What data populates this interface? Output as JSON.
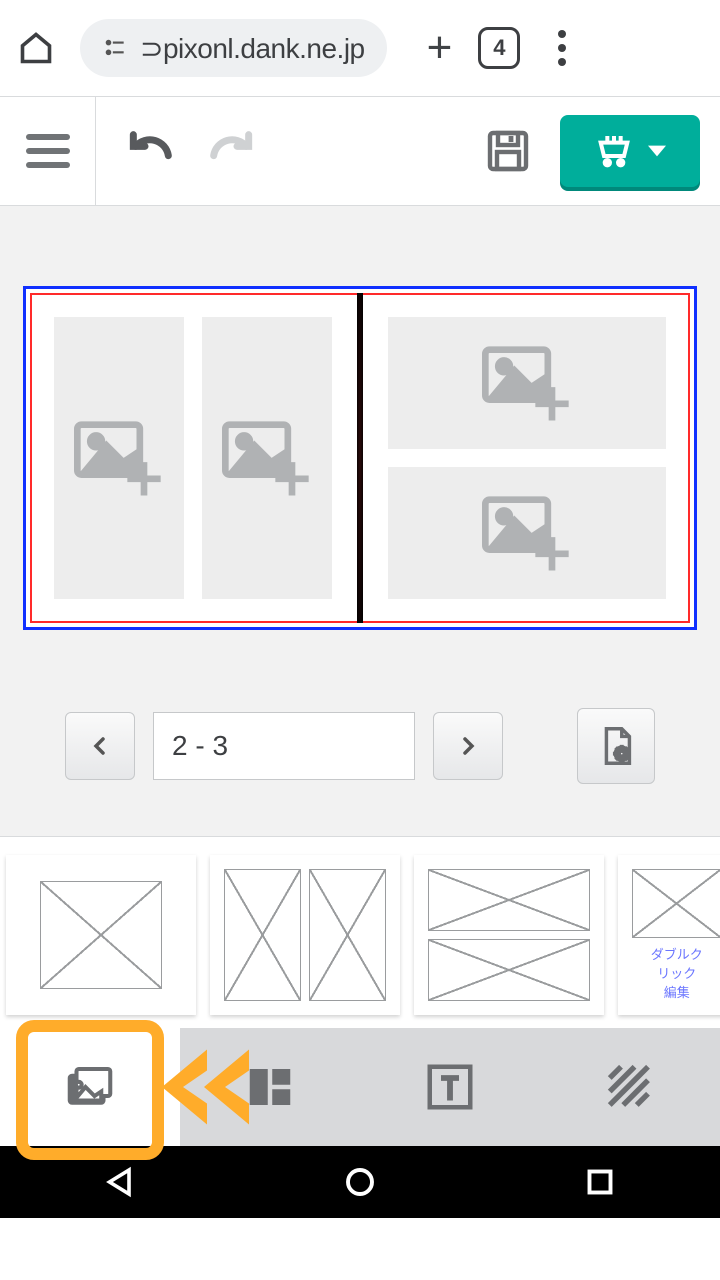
{
  "browser": {
    "url_prefix_icon": "⊃",
    "url": "pixonl.dank.ne.jp",
    "tab_count": "4"
  },
  "toolbar": {
    "cart_dropdown": "▼"
  },
  "editor": {
    "page_range": "2 - 3"
  },
  "thumbs": {
    "jp_line1": "ダブルク",
    "jp_line2": "リック",
    "jp_line3": "編集"
  }
}
